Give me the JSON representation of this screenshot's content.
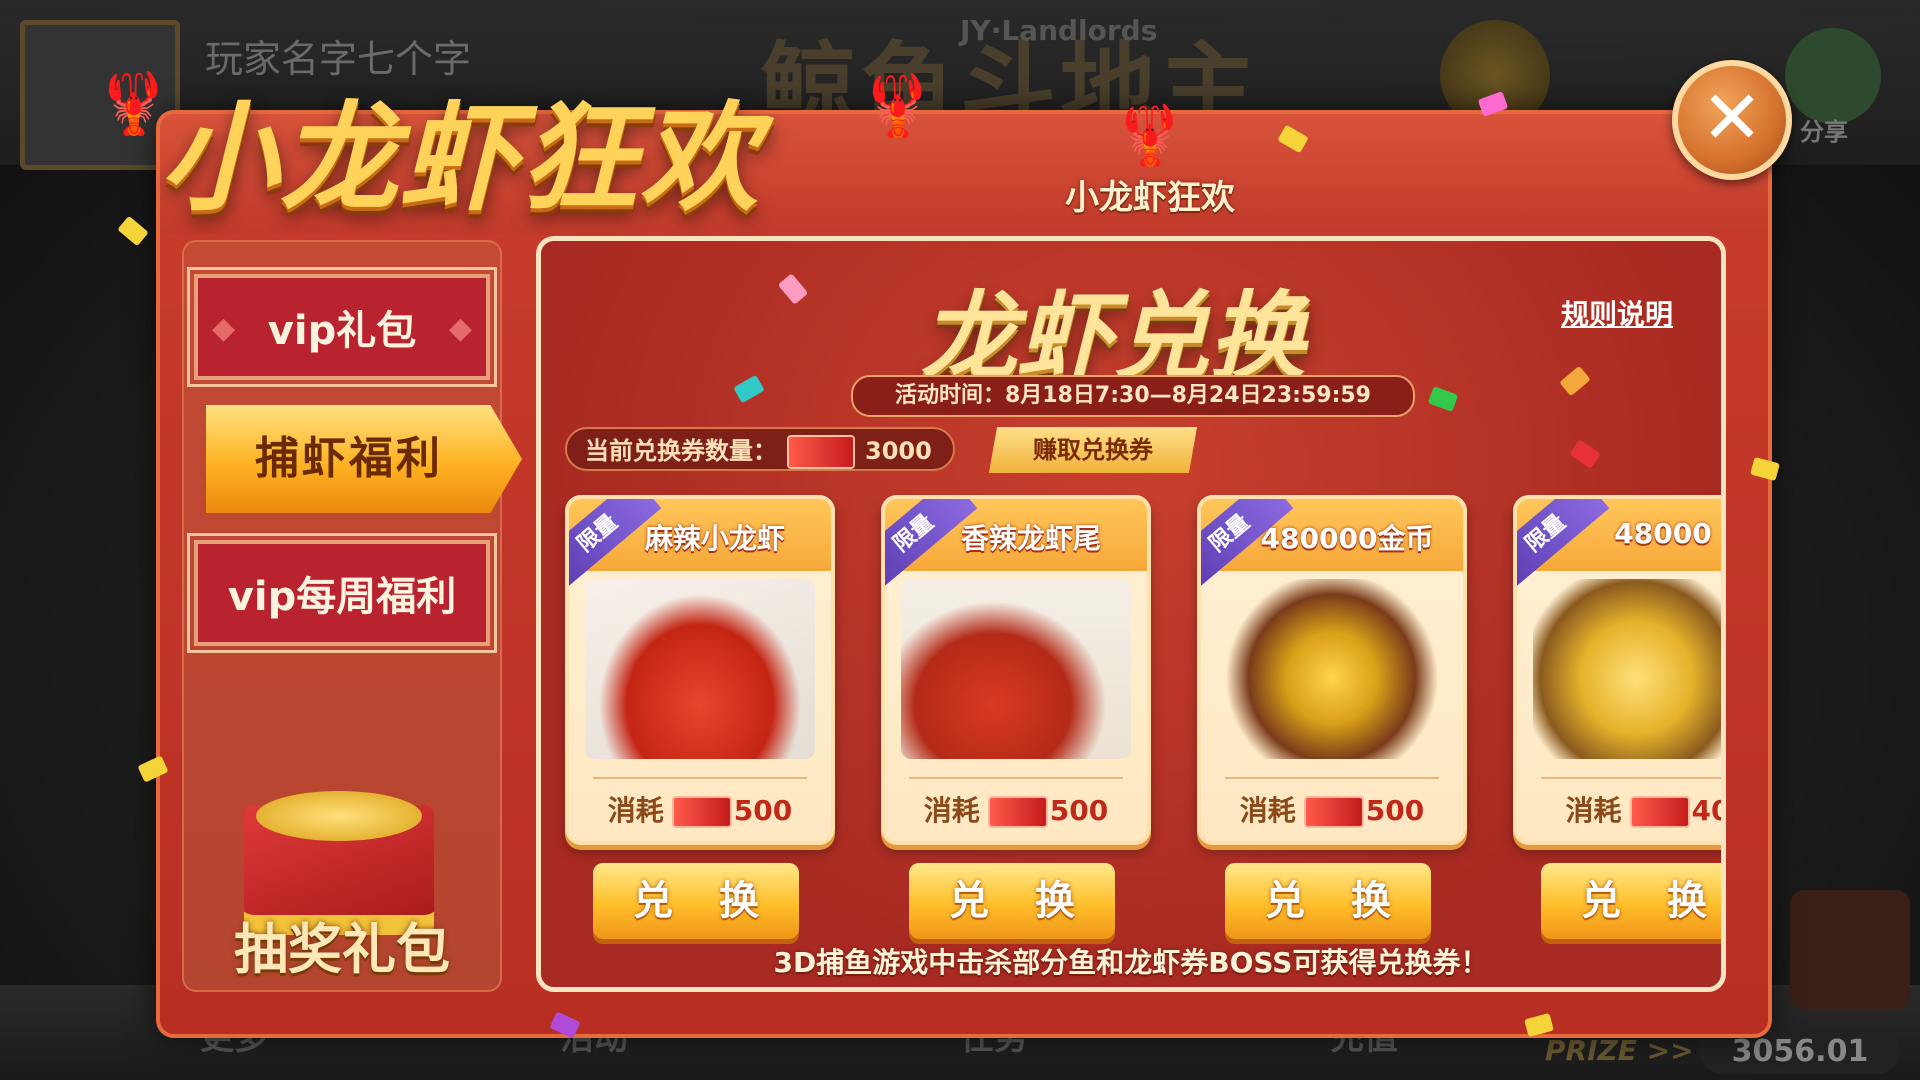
{
  "background": {
    "player_name": "玩家名字七个字",
    "logo": "鲸鱼斗地主",
    "logo_en": "JY·Landlords",
    "share_label": "分享",
    "bottom_labels": [
      "更多",
      "活动",
      "任务",
      "充值"
    ],
    "prize_label": "PRIZE >>",
    "score": "3056.01"
  },
  "event": {
    "title": "小龙虾狂欢",
    "badge_label": "小龙虾狂欢"
  },
  "sidebar": {
    "items": [
      {
        "label": "vip礼包",
        "active": false
      },
      {
        "label": "捕虾福利",
        "active": true
      },
      {
        "label": "vip每周福利",
        "active": false
      }
    ],
    "lottery_label": "抽奖礼包"
  },
  "exchange": {
    "title": "龙虾兑换",
    "rules_label": "规则说明",
    "activity_time": "活动时间：8月18日7:30—8月24日23:59:59",
    "voucher_label": "当前兑换券数量：",
    "voucher_count": "3000",
    "earn_button": "赚取兑换券",
    "cost_label": "消耗",
    "limit_tag": "限量",
    "exchange_button": "兑 换",
    "footer_note": "3D捕鱼游戏中击杀部分鱼和龙虾券BOSS可获得兑换券！",
    "items": [
      {
        "name": "麻辣小龙虾",
        "cost": "500"
      },
      {
        "name": "香辣龙虾尾",
        "cost": "500"
      },
      {
        "name": "480000金币",
        "cost": "500"
      },
      {
        "name": "48000",
        "cost": "40"
      }
    ]
  },
  "colors": {
    "panel_red": "#c13a2a",
    "gold": "#ffbf2a",
    "card_cream": "#fff1d4",
    "ribbon_purple": "#6a4bc0"
  }
}
